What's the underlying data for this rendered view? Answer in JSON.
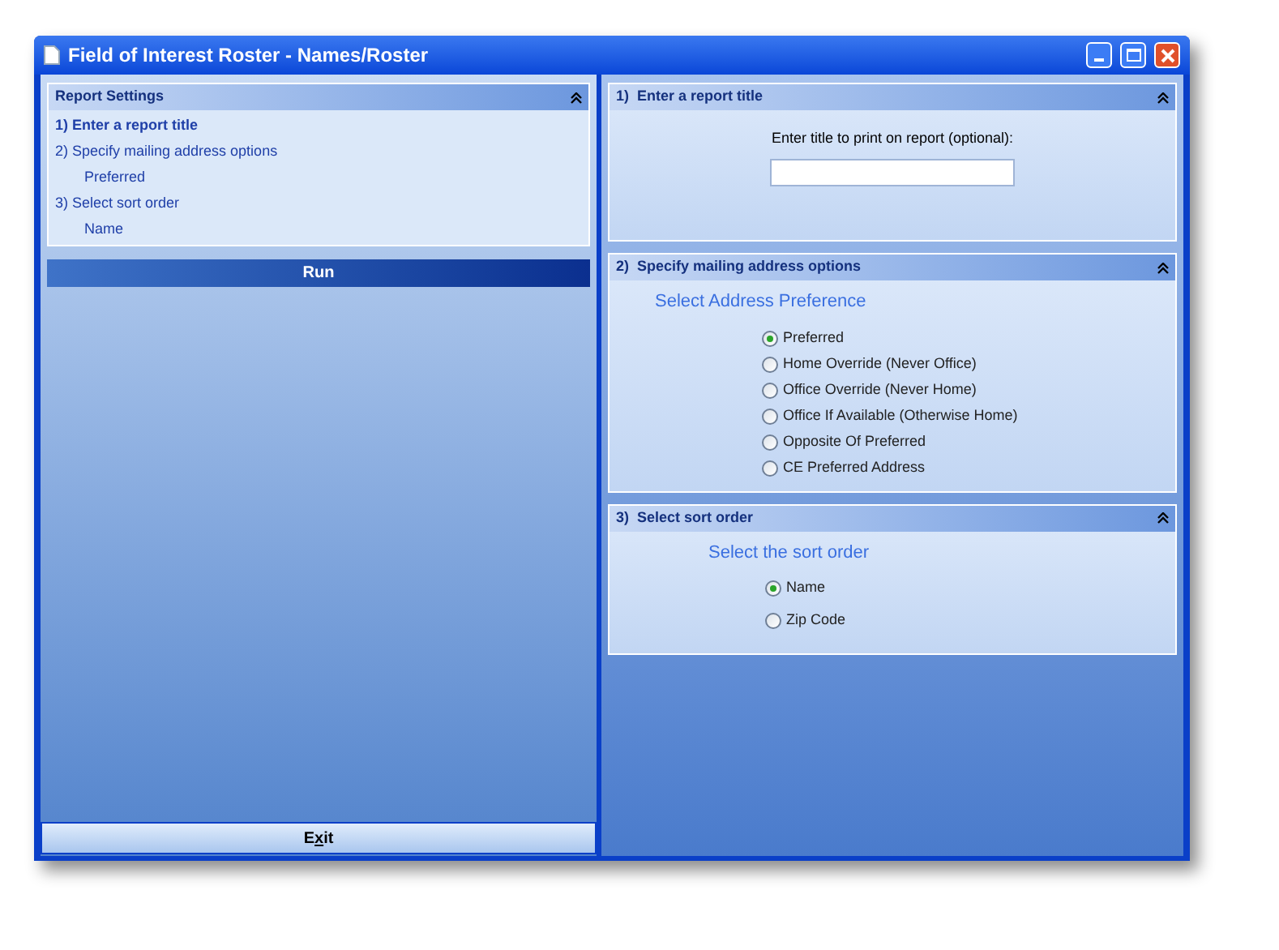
{
  "window": {
    "title": "Field of Interest Roster - Names/Roster"
  },
  "report_settings": {
    "title": "Report Settings",
    "items": [
      {
        "kind": "step",
        "text": "1)  Enter a report title",
        "selected": true
      },
      {
        "kind": "step",
        "text": "2)  Specify mailing address options",
        "selected": false
      },
      {
        "kind": "value",
        "text": "Preferred"
      },
      {
        "kind": "step",
        "text": "3)  Select sort order",
        "selected": false
      },
      {
        "kind": "value",
        "text": "Name"
      }
    ]
  },
  "run_button": "Run",
  "exit_button": {
    "label_parts": [
      "E",
      "x",
      "it"
    ]
  },
  "sections": [
    {
      "title": "1)  Enter a report title",
      "kind": "text",
      "prompt": "Enter title to print on report (optional):"
    },
    {
      "title": "2)  Specify mailing address options",
      "kind": "radio",
      "heading": "Select Address Preference",
      "options": [
        {
          "label": "Preferred",
          "selected": true
        },
        {
          "label": "Home Override (Never Office)",
          "selected": false
        },
        {
          "label": "Office Override (Never Home)",
          "selected": false
        },
        {
          "label": "Office If Available (Otherwise Home)",
          "selected": false
        },
        {
          "label": "Opposite Of Preferred",
          "selected": false
        },
        {
          "label": "CE Preferred Address",
          "selected": false
        }
      ]
    },
    {
      "title": "3)  Select sort order",
      "kind": "radio",
      "heading": "Select the sort order",
      "options": [
        {
          "label": "Name",
          "selected": true
        },
        {
          "label": "Zip Code",
          "selected": false
        }
      ]
    }
  ]
}
